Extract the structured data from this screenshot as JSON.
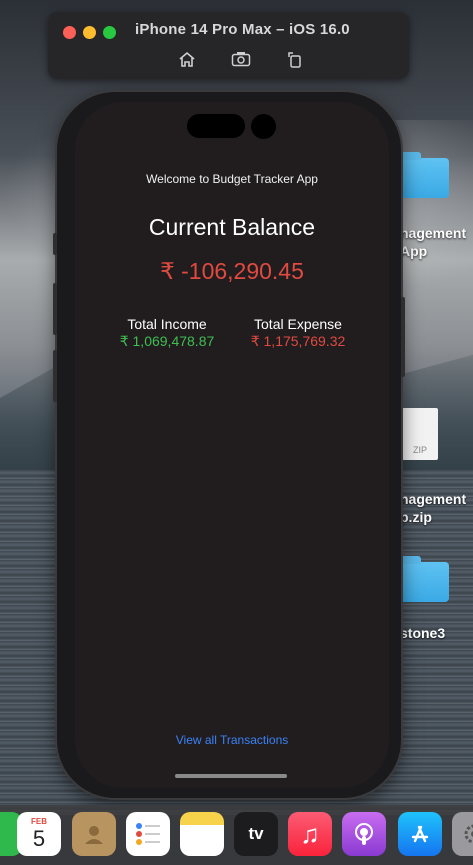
{
  "simulator": {
    "title": "iPhone 14 Pro Max – iOS 16.0",
    "toolbar_icons": [
      "home-icon",
      "screenshot-icon",
      "rotate-icon"
    ]
  },
  "desktop": {
    "items": [
      {
        "label_line1": "nagement",
        "label_line2": "App",
        "icon": "folder-icon"
      },
      {
        "label_line1": "nagement",
        "label_line2": "p.zip",
        "icon": "zip-file-icon",
        "badge": "ZIP"
      },
      {
        "label_line1": "stone3",
        "label_line2": "",
        "icon": "folder-icon"
      }
    ]
  },
  "app": {
    "welcome": "Welcome to Budget Tracker App",
    "balance_label": "Current Balance",
    "balance_value": "₹ -106,290.45",
    "income_label": "Total Income",
    "income_value": "₹ 1,069,478.87",
    "expense_label": "Total Expense",
    "expense_value": "₹ 1,175,769.32",
    "view_all": "View all Transactions",
    "colors": {
      "income": "#3fbf52",
      "expense": "#e04a40",
      "link": "#3a82f6"
    }
  },
  "dock": {
    "apps": [
      {
        "name": "facetime-icon"
      },
      {
        "name": "calendar-icon",
        "month": "FEB",
        "day": "5"
      },
      {
        "name": "contacts-icon"
      },
      {
        "name": "reminders-icon"
      },
      {
        "name": "notes-icon"
      },
      {
        "name": "apple-tv-icon",
        "label": "tv"
      },
      {
        "name": "music-icon"
      },
      {
        "name": "podcasts-icon"
      },
      {
        "name": "app-store-icon"
      },
      {
        "name": "system-settings-icon"
      }
    ]
  }
}
